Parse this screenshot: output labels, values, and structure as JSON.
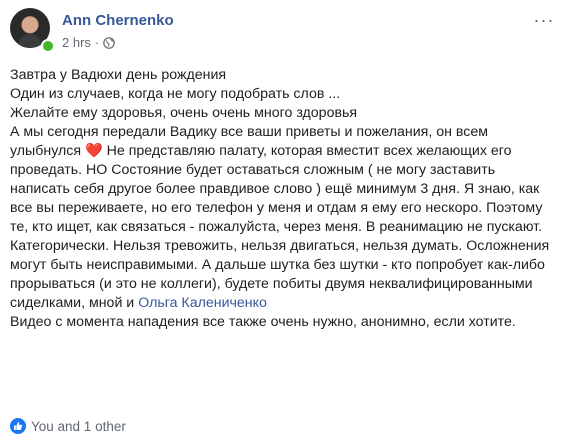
{
  "post": {
    "author": "Ann Chernenko",
    "time": "2 hrs",
    "separator": "·",
    "privacy_icon": "globe-icon",
    "more_icon": "more-dots-icon",
    "paragraphs": [
      "Завтра у Вадюхи день рождения",
      "Один из случаев, когда не могу подобрать слов ...",
      "Желайте ему здоровья, очень очень много здоровья",
      "А мы сегодня передали Вадику все ваши приветы и пожелания, он всем улыбнулся"
    ],
    "heart": "❤️",
    "after_heart": " Не представляю палату, которая вместит всех желающих его проведать. НО Состояние будет оставаться сложным ( не могу заставить написать себя другое более правдивое слово ) ещё минимум 3 дня. Я знаю, как все вы переживаете, но его телефон у меня и отдам я ему его нескоро. Поэтому те, кто ищет, как связаться - пожалуйста, через меня. В реанимацию не пускают. Категорически. Нельзя тревожить, нельзя двигаться, нельзя думать. Осложнения могут быть неисправимыми. А дальше шутка без шутки - кто попробует как-либо прорываться (и это не коллеги), будете побиты двумя неквалифицированными сиделками, мной и ",
    "mention": "Ольга Калениченко",
    "last_paragraph": "Видео с момента нападения все также очень нужно, анонимно, если хотите."
  },
  "reactions": {
    "icon": "like-icon",
    "text": "You and 1 other",
    "color": "#1877f2"
  },
  "colors": {
    "link": "#385898",
    "text": "#1c1e21",
    "meta": "#616770",
    "heart": "#e0245e"
  }
}
